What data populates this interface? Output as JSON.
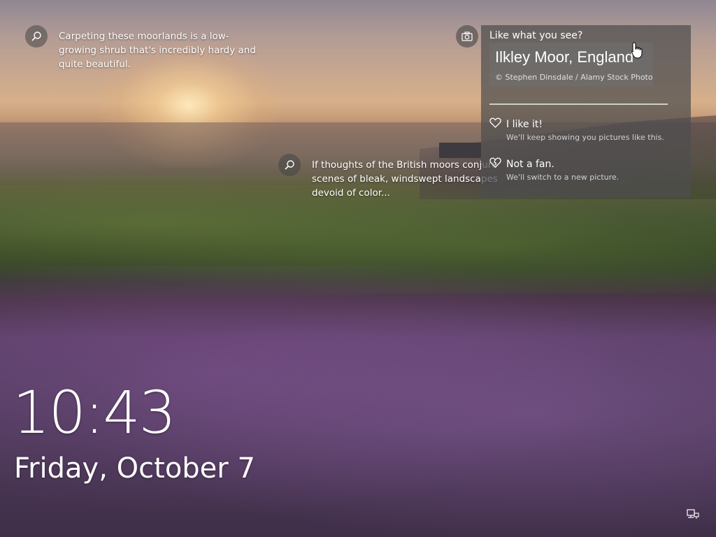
{
  "hotspots": [
    {
      "text": "Carpeting these moorlands is a low-growing shrub that's incredibly hardy and quite beautiful.",
      "icon": "search-icon"
    },
    {
      "text": "If thoughts of the British moors conjure scenes of bleak, windswept landscapes devoid of color...",
      "icon": "search-icon"
    }
  ],
  "spotlight": {
    "heading": "Like what you see?",
    "location": "Ilkley Moor, England",
    "credit": "© Stephen Dinsdale / Alamy Stock Photo",
    "camera_icon": "camera-icon",
    "options": [
      {
        "label": "I like it!",
        "sub": "We'll keep showing you pictures like this.",
        "icon": "heart-icon"
      },
      {
        "label": "Not a fan.",
        "sub": "We'll switch to a new picture.",
        "icon": "broken-heart-icon"
      }
    ]
  },
  "clock": {
    "time": "10:43",
    "date": "Friday, October 7"
  },
  "tray": {
    "network_icon": "network-icon"
  },
  "colors": {
    "panel_bg": "#4e4e4e",
    "credit_bg": "#6e6e6e",
    "text": "#ffffff",
    "subtext": "#d0d0d0"
  }
}
